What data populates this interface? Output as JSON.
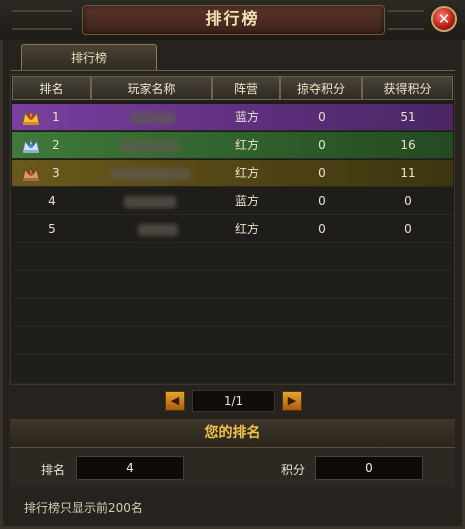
{
  "window": {
    "title": "排行榜",
    "close_label": "✕"
  },
  "tabs": [
    {
      "label": "排行榜",
      "active": true
    }
  ],
  "table": {
    "headers": [
      "排名",
      "玩家名称",
      "阵营",
      "掠夺积分",
      "获得积分"
    ],
    "rows": [
      {
        "rank": "1",
        "camp": "蓝方",
        "loot": "0",
        "gain": "51",
        "crown": "gold-crown"
      },
      {
        "rank": "2",
        "camp": "红方",
        "loot": "0",
        "gain": "16",
        "crown": "silver-crown"
      },
      {
        "rank": "3",
        "camp": "红方",
        "loot": "0",
        "gain": "11",
        "crown": "bronze-crown"
      },
      {
        "rank": "4",
        "camp": "蓝方",
        "loot": "0",
        "gain": "0"
      },
      {
        "rank": "5",
        "camp": "红方",
        "loot": "0",
        "gain": "0"
      }
    ]
  },
  "pager": {
    "label": "1/1",
    "prev_icon": "left-arrow-icon",
    "next_icon": "right-arrow-icon"
  },
  "my_rank": {
    "title": "您的排名",
    "rank_label": "排名",
    "rank_value": "4",
    "score_label": "积分",
    "score_value": "0"
  },
  "note": "排行榜只显示前200名",
  "colors": {
    "row1": "#6a359a",
    "row2": "#35693a",
    "row3": "#5c4f16",
    "accent": "#f0c24a"
  }
}
